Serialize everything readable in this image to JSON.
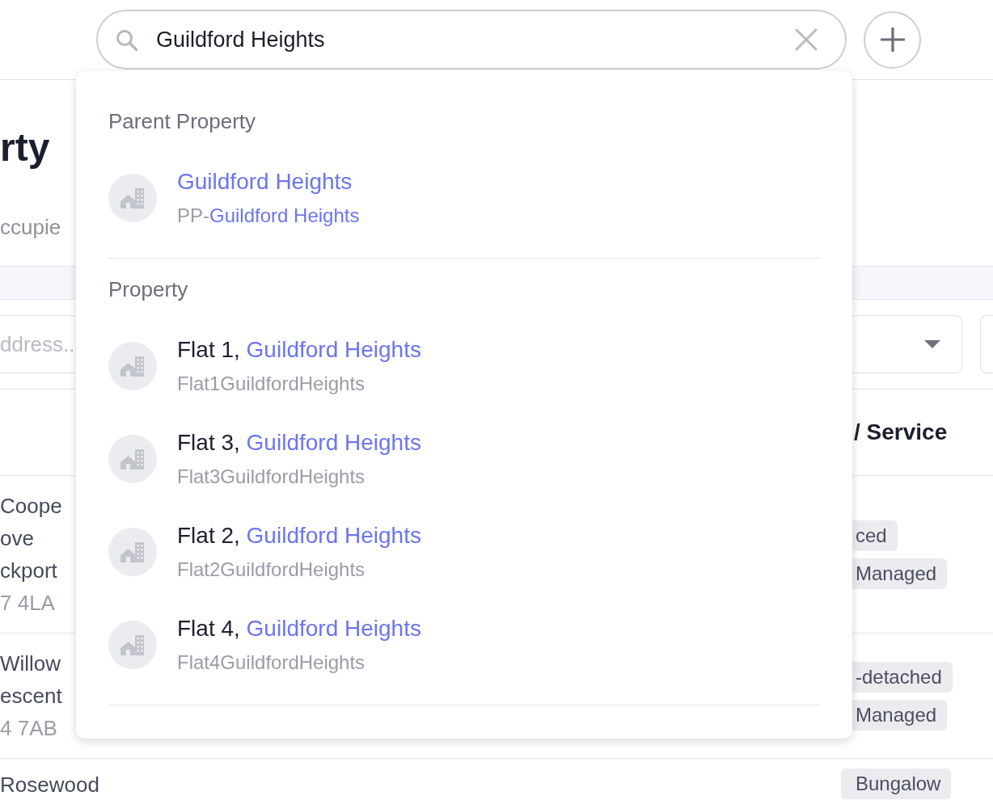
{
  "search": {
    "value": "Guildford Heights"
  },
  "dropdown": {
    "sections": [
      {
        "heading": "Parent Property",
        "results": [
          {
            "title": [
              {
                "text": "Guildford Heights",
                "highlighted": true
              }
            ],
            "subtitle": [
              {
                "text": "PP-",
                "highlighted": false
              },
              {
                "text": "Guildford Heights",
                "highlighted": true
              }
            ]
          }
        ]
      },
      {
        "heading": "Property",
        "results": [
          {
            "title": [
              {
                "text": "Flat 1, ",
                "highlighted": false
              },
              {
                "text": "Guildford Heights",
                "highlighted": true
              }
            ],
            "subtitle": [
              {
                "text": "Flat1GuildfordHeights",
                "highlighted": false
              }
            ]
          },
          {
            "title": [
              {
                "text": "Flat 3, ",
                "highlighted": false
              },
              {
                "text": "Guildford Heights",
                "highlighted": true
              }
            ],
            "subtitle": [
              {
                "text": "Flat3GuildfordHeights",
                "highlighted": false
              }
            ]
          },
          {
            "title": [
              {
                "text": "Flat 2, ",
                "highlighted": false
              },
              {
                "text": "Guildford Heights",
                "highlighted": true
              }
            ],
            "subtitle": [
              {
                "text": "Flat2GuildfordHeights",
                "highlighted": false
              }
            ]
          },
          {
            "title": [
              {
                "text": "Flat 4, ",
                "highlighted": false
              },
              {
                "text": "Guildford Heights",
                "highlighted": true
              }
            ],
            "subtitle": [
              {
                "text": "Flat4GuildfordHeights",
                "highlighted": false
              }
            ]
          }
        ]
      }
    ]
  },
  "page": {
    "title": "rty",
    "subtitle": "ccupie"
  },
  "filters": {
    "address_placeholder": "ddress.."
  },
  "table": {
    "header": "/ Service",
    "rows": [
      {
        "address_lines": [
          "Coope",
          "ove",
          "ckport"
        ],
        "postcode": "7 4LA",
        "tags": [
          "ced",
          "Managed"
        ]
      },
      {
        "address_lines": [
          "Willow",
          "escent"
        ],
        "postcode": "4 7AB",
        "tags": [
          "-detached",
          "Managed"
        ]
      },
      {
        "address_lines": [
          "Rosewood"
        ],
        "tags": [
          "Bungalow"
        ]
      }
    ]
  }
}
